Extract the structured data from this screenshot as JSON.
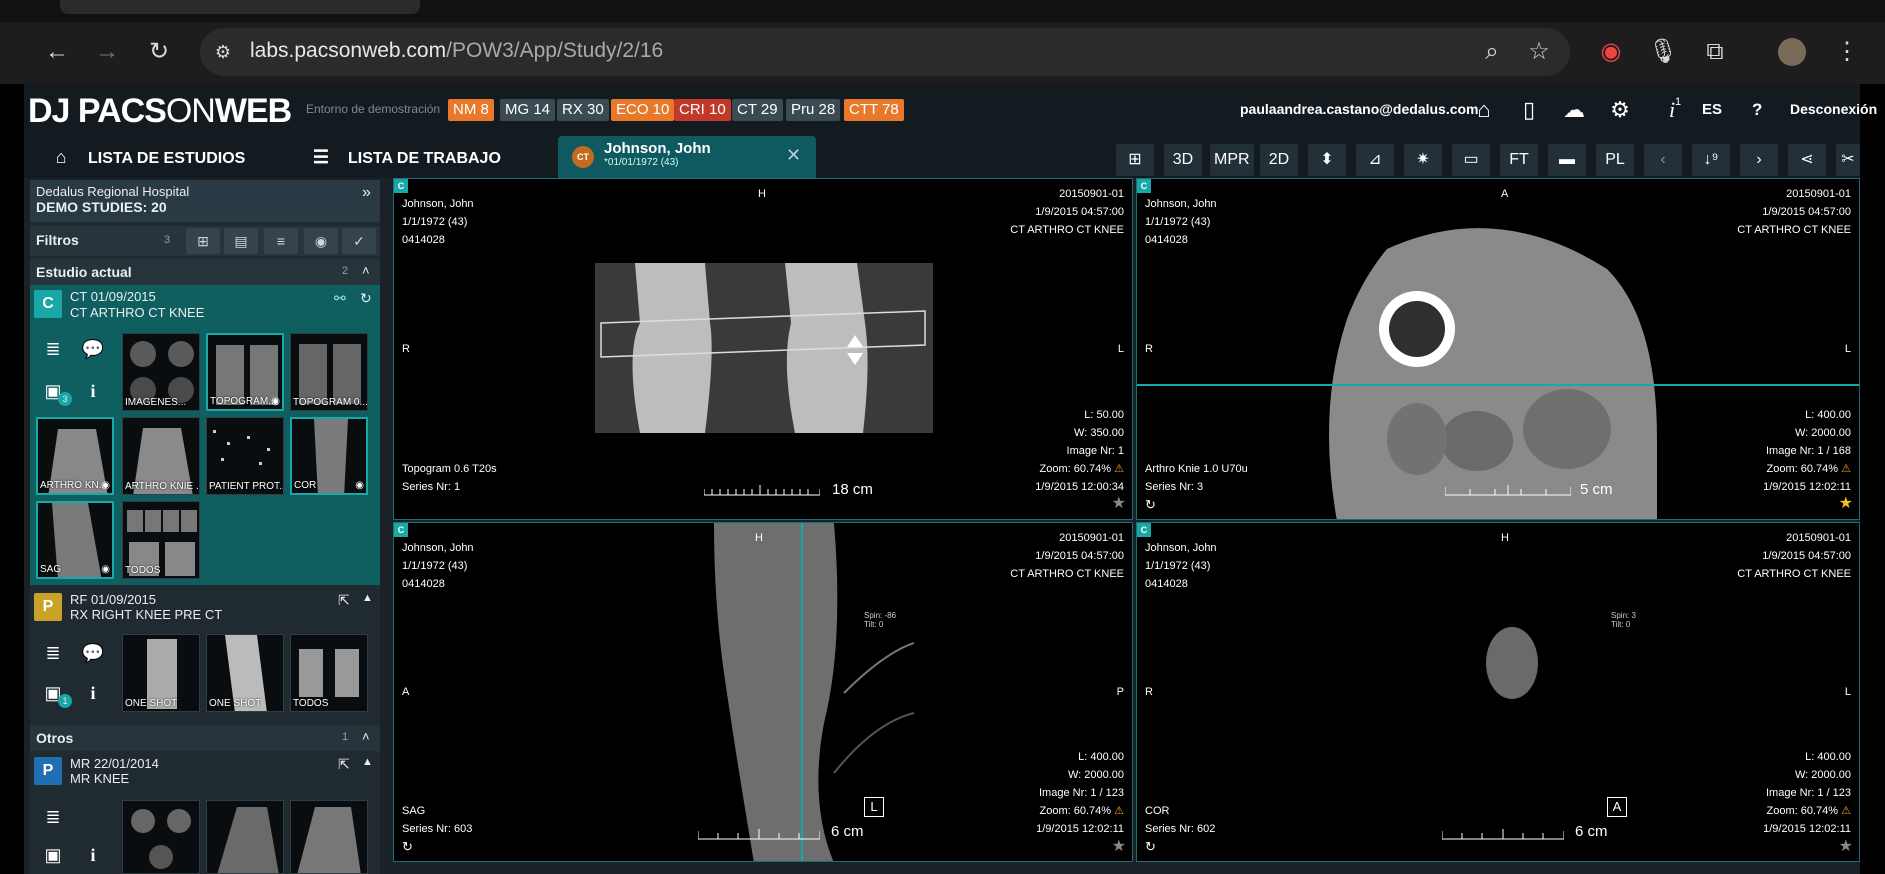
{
  "browser": {
    "url_host": "labs.pacsonweb.com",
    "url_path": "/POW3/App/Study/2/16"
  },
  "header": {
    "logo_a": "DJ PACS",
    "logo_b": "ON",
    "logo_c": "WEB",
    "env_label": "Entorno de demostración",
    "badges": [
      {
        "label": "NM 8",
        "color": "#e8792a"
      },
      {
        "label": "MG 14",
        "color": "#3c4a53"
      },
      {
        "label": "RX 30",
        "color": "#3c4a53"
      },
      {
        "label": "ECO 10",
        "color": "#e8792a"
      },
      {
        "label": "CRI 10",
        "color": "#c0392b"
      },
      {
        "label": "CT 29",
        "color": "#3c4a53"
      },
      {
        "label": "Pru 28",
        "color": "#3c4a53"
      },
      {
        "label": "CTT 78",
        "color": "#e8792a"
      }
    ],
    "user_email": "paulaandrea.castano@dedalus.com",
    "info_count": "1",
    "lang": "ES",
    "help": "?",
    "logout": "Desconexión"
  },
  "nav": {
    "studies_tab": "LISTA DE ESTUDIOS",
    "worklist_tab": "LISTA DE TRABAJO",
    "patient_tab_badge": "CT",
    "patient_name": "Johnson, John",
    "patient_dob": "*01/01/1972 (43)",
    "toolbar": [
      "3D",
      "MPR",
      "2D",
      "FT",
      "PL"
    ]
  },
  "sidebar": {
    "hospital": "Dedalus Regional Hospital",
    "demo_studies": "DEMO STUDIES: 20",
    "filters_label": "Filtros",
    "filters_count": "3",
    "current_section": "Estudio actual",
    "current_count": "2",
    "others_section": "Otros",
    "others_count": "1",
    "studies": [
      {
        "modality": "C",
        "color": "#1aa7a7",
        "date": "CT 01/09/2015",
        "desc": "CT ARTHRO CT KNEE",
        "doc_count": "3",
        "thumbs": [
          "IMAGENES...",
          "TOPOGRAM...",
          "TOPOGRAM 0...",
          "ARTHRO KN...",
          "ARTHRO KNIE ...",
          "PATIENT PROT...",
          "COR",
          "SAG",
          "TODOS"
        ]
      },
      {
        "modality": "P",
        "color": "#c9a227",
        "date": "RF 01/09/2015",
        "desc": "RX RIGHT KNEE PRE CT",
        "doc_count": "1",
        "thumbs": [
          "ONE SHOT",
          "ONE SHOT",
          "TODOS"
        ]
      },
      {
        "modality": "P",
        "color": "#1f6fb2",
        "date": "MR 22/01/2014",
        "desc": "MR KNEE"
      }
    ]
  },
  "viewports": [
    {
      "num": "C",
      "name": "Johnson, John",
      "dob": "1/1/1972 (43)",
      "id": "0414028",
      "study_id": "20150901-01",
      "study_time": "1/9/2015 04:57:00",
      "study_desc": "CT ARTHRO CT KNEE",
      "top": "H",
      "left": "R",
      "right": "L",
      "window_l": "L: 50.00",
      "window_w": "W: 350.00",
      "image_nr": "Image Nr: 1",
      "zoom": "Zoom: 60.74%",
      "series_desc": "Topogram 0.6 T20s",
      "series_nr": "Series Nr: 1",
      "img_time": "1/9/2015 12:00:34",
      "scale": "18 cm"
    },
    {
      "num": "C",
      "name": "Johnson, John",
      "dob": "1/1/1972 (43)",
      "id": "0414028",
      "study_id": "20150901-01",
      "study_time": "1/9/2015 04:57:00",
      "study_desc": "CT ARTHRO CT KNEE",
      "top": "A",
      "left": "R",
      "right": "L",
      "window_l": "L: 400.00",
      "window_w": "W: 2000.00",
      "image_nr": "Image Nr: 1 / 168",
      "zoom": "Zoom: 60.74%",
      "series_desc": "Arthro Knie 1.0 U70u",
      "series_nr": "Series Nr: 3",
      "img_time": "1/9/2015 12:02:11",
      "scale": "5 cm"
    },
    {
      "num": "C",
      "name": "Johnson, John",
      "dob": "1/1/1972 (43)",
      "id": "0414028",
      "study_id": "20150901-01",
      "study_time": "1/9/2015 04:57:00",
      "study_desc": "CT ARTHRO CT KNEE",
      "top": "H",
      "left": "A",
      "right": "P",
      "window_l": "L: 400.00",
      "window_w": "W: 2000.00",
      "image_nr": "Image Nr: 1 / 123",
      "zoom": "Zoom: 60.74%",
      "series_desc": "SAG",
      "series_nr": "Series Nr: 603",
      "img_time": "1/9/2015 12:02:11",
      "scale": "6 cm",
      "marker": "L",
      "spin": "Spin: -86",
      "tilt": "Tilt: 0"
    },
    {
      "num": "C",
      "name": "Johnson, John",
      "dob": "1/1/1972 (43)",
      "id": "0414028",
      "study_id": "20150901-01",
      "study_time": "1/9/2015 04:57:00",
      "study_desc": "CT ARTHRO CT KNEE",
      "top": "H",
      "left": "R",
      "right": "L",
      "window_l": "L: 400.00",
      "window_w": "W: 2000.00",
      "image_nr": "Image Nr: 1 / 123",
      "zoom": "Zoom: 60.74%",
      "series_desc": "COR",
      "series_nr": "Series Nr: 602",
      "img_time": "1/9/2015 12:02:11",
      "scale": "6 cm",
      "marker": "A",
      "spin": "Spin: 3",
      "tilt": "Tilt: 0"
    }
  ]
}
